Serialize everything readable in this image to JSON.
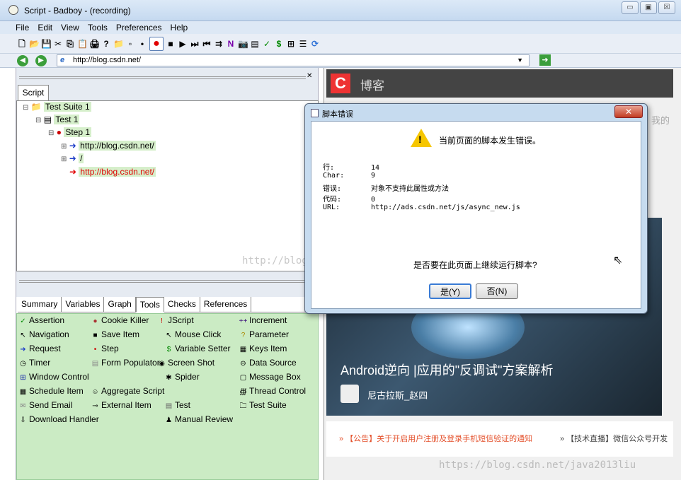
{
  "window": {
    "title": "Script - Badboy - (recording)",
    "controls": [
      "▭",
      "▣",
      "☒"
    ]
  },
  "menu": [
    "File",
    "Edit",
    "View",
    "Tools",
    "Preferences",
    "Help"
  ],
  "toolbar": [
    "🗋",
    "📂",
    "💾",
    "✂",
    "⎘",
    "📋",
    "🖨",
    "?",
    "📁",
    "▫",
    "•",
    "",
    "■",
    "▶",
    "⏭",
    "⏮",
    "⇉",
    "N",
    "📷",
    "▤",
    "✓",
    "$",
    "⊞",
    "☰",
    "⟳"
  ],
  "address": {
    "url": "http://blog.csdn.net/"
  },
  "left": {
    "script_tab": "Script",
    "tree": [
      {
        "label": "Test Suite 1",
        "toggle": "⊟",
        "icon": "📁",
        "color": "#000"
      },
      {
        "label": "Test 1",
        "toggle": "⊟",
        "icon": "▤",
        "color": "#000"
      },
      {
        "label": "Step 1",
        "toggle": "⊟",
        "icon": "●",
        "color": "#000"
      },
      {
        "label": "http://blog.csdn.net/",
        "toggle": "⊞",
        "icon": "➜",
        "color": "#000"
      },
      {
        "label": "/",
        "toggle": "⊞",
        "icon": "➜",
        "color": "#000"
      },
      {
        "label": "http://blog.csdn.net/",
        "toggle": "",
        "icon": "➜",
        "color": "#e00000"
      }
    ],
    "tabs": [
      "Summary",
      "Variables",
      "Graph",
      "Tools",
      "Checks",
      "References"
    ],
    "active_tab": "Tools",
    "tools": [
      [
        "Assertion",
        "Cookie Killer",
        "JScript",
        "Increment"
      ],
      [
        "Navigation",
        "Save Item",
        "Mouse Click",
        "Parameter"
      ],
      [
        "Request",
        "Step",
        "Variable Setter",
        "Keys Item"
      ],
      [
        "Timer",
        "Form Populator",
        "Screen Shot",
        "Data Source"
      ],
      [
        "Window Control",
        "Spider",
        "Message Box"
      ],
      [
        "Schedule Item",
        "Aggregate Script",
        "Thread Control"
      ],
      [
        "Send Email",
        "External Item",
        "Test",
        "Test Suite"
      ],
      [
        "Download Handler",
        "Manual Review"
      ]
    ]
  },
  "browser": {
    "brand": "博客",
    "hero_title": "Android逆向 |应用的\"反调试\"方案解析",
    "author": "尼古拉斯_赵四",
    "notice1": "» 【公告】关于开启用户注册及登录手机短信验证的通知",
    "notice2": "» 【技术直播】微信公众号开发",
    "side_text": "我的"
  },
  "watermarks": {
    "center": "http://blog.csdn.net/laof...2015",
    "bottom": "https://blog.csdn.net/java2013liu"
  },
  "dialog": {
    "title": "脚本错误",
    "message": "当前页面的脚本发生错误。",
    "fields": [
      {
        "k": "行:",
        "v": "14"
      },
      {
        "k": "Char:",
        "v": "9"
      },
      {
        "k": "错误:",
        "v": "对象不支持此属性或方法"
      },
      {
        "k": "代码:",
        "v": "0"
      },
      {
        "k": "URL:",
        "v": "http://ads.csdn.net/js/async_new.js"
      }
    ],
    "question": "是否要在此页面上继续运行脚本?",
    "yes": "是(Y)",
    "no": "否(N)",
    "close": "✕"
  }
}
